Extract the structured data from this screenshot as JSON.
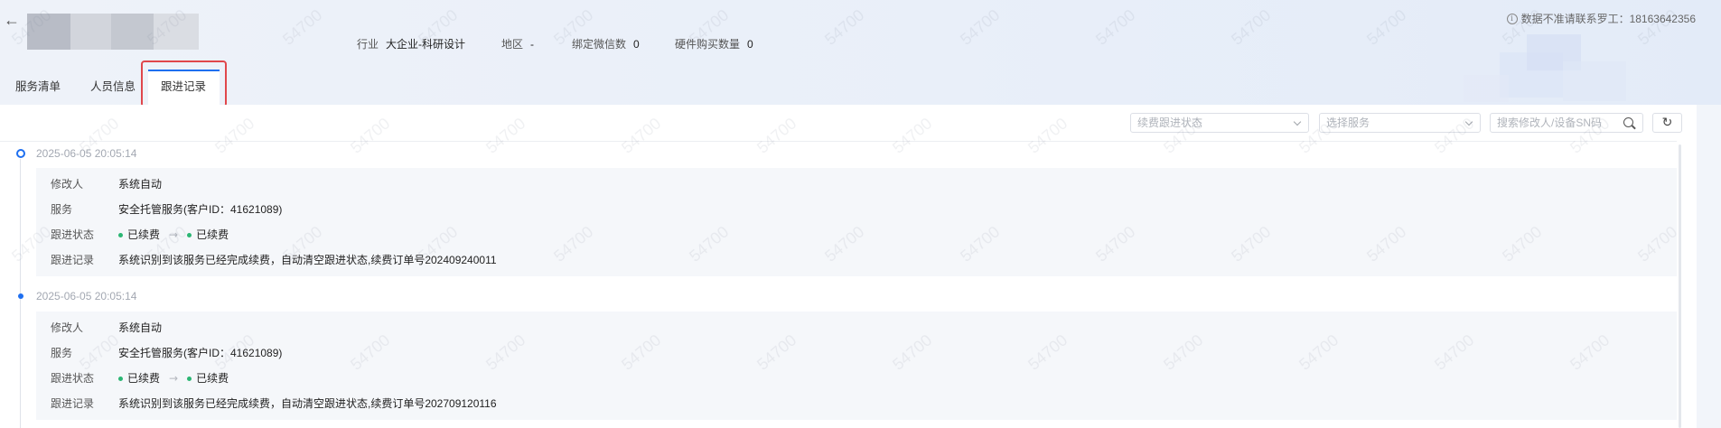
{
  "header": {
    "back_icon": "arrow-left-icon",
    "back_glyph": "←",
    "info": [
      {
        "label": "行业",
        "value": "大企业-科研设计"
      },
      {
        "label": "地区",
        "value": "-"
      },
      {
        "label": "绑定微信数",
        "value": "0"
      },
      {
        "label": "硬件购买数量",
        "value": "0"
      }
    ],
    "notice_icon": "i",
    "notice": "数据不准请联系罗工：18163642356"
  },
  "tabs": [
    {
      "label": "服务清单",
      "active": false
    },
    {
      "label": "人员信息",
      "active": false
    },
    {
      "label": "跟进记录",
      "active": true
    }
  ],
  "filters": {
    "status_placeholder": "续费跟进状态",
    "service_placeholder": "选择服务",
    "search_placeholder": "搜索修改人/设备SN码",
    "refresh_glyph": "↻"
  },
  "timeline": [
    {
      "date": "2025-06-05 20:05:14",
      "rows": [
        {
          "label": "修改人",
          "value": "系统自动"
        },
        {
          "label": "服务",
          "value": "安全托管服务(客户ID：41621089)"
        },
        {
          "label": "跟进状态",
          "from": "已续费",
          "arrow": "→",
          "to": "已续费"
        },
        {
          "label": "跟进记录",
          "value": "系统识别到该服务已经完成续费，自动清空跟进状态,续费订单号202409240011"
        }
      ]
    },
    {
      "date": "2025-06-05 20:05:14",
      "rows": [
        {
          "label": "修改人",
          "value": "系统自动"
        },
        {
          "label": "服务",
          "value": "安全托管服务(客户ID：41621089)"
        },
        {
          "label": "跟进状态",
          "from": "已续费",
          "arrow": "→",
          "to": "已续费"
        },
        {
          "label": "跟进记录",
          "value": "系统识别到该服务已经完成续费，自动清空跟进状态,续费订单号202709120116"
        }
      ]
    }
  ],
  "watermark": "54700",
  "colors": {
    "accent": "#1e6ff0",
    "highlight": "#e0474c",
    "status_green": "#2bb673"
  }
}
